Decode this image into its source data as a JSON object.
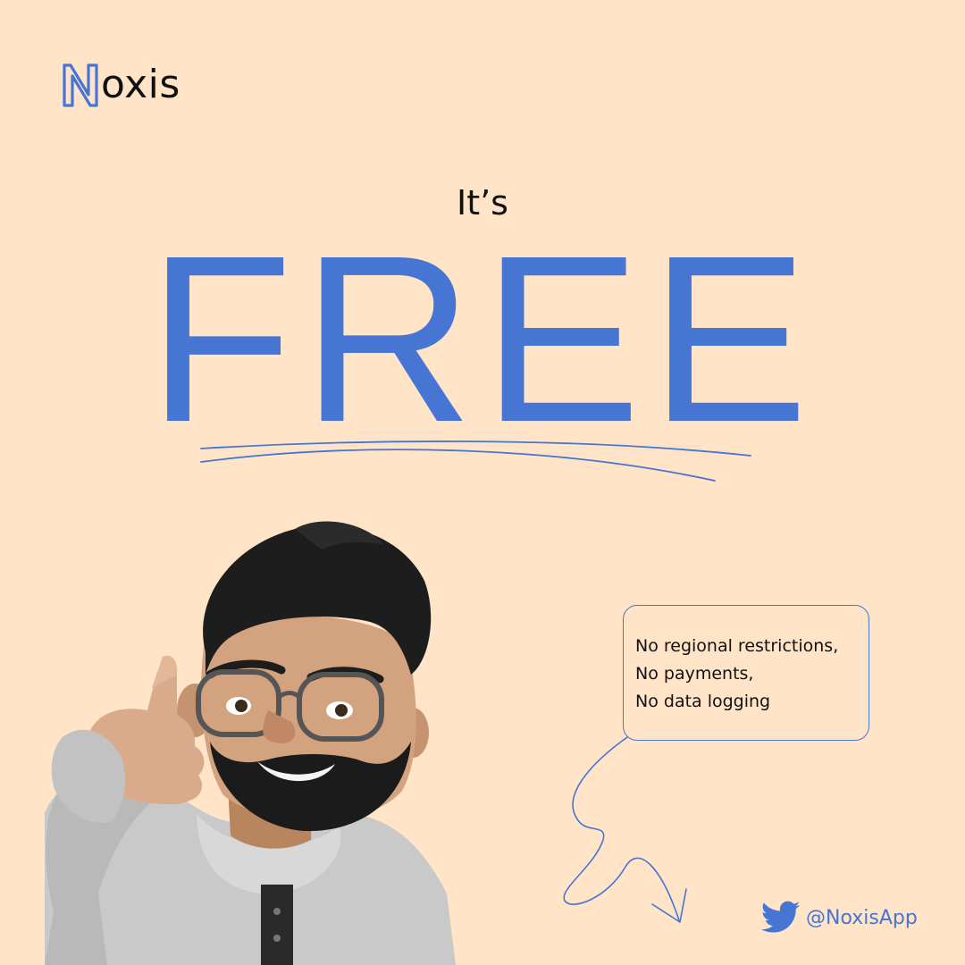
{
  "brand": {
    "logo_letter": "N",
    "logo_rest": "oxis"
  },
  "headline": {
    "intro": "It’s",
    "main": "FREE"
  },
  "bubble": {
    "lines": [
      "No regional restrictions,",
      "No payments,",
      "No data logging"
    ]
  },
  "social": {
    "icon": "twitter-icon",
    "handle": "@NoxisApp"
  },
  "colors": {
    "background": "#ffe4c8",
    "accent": "#4675d4",
    "text": "#111111"
  }
}
